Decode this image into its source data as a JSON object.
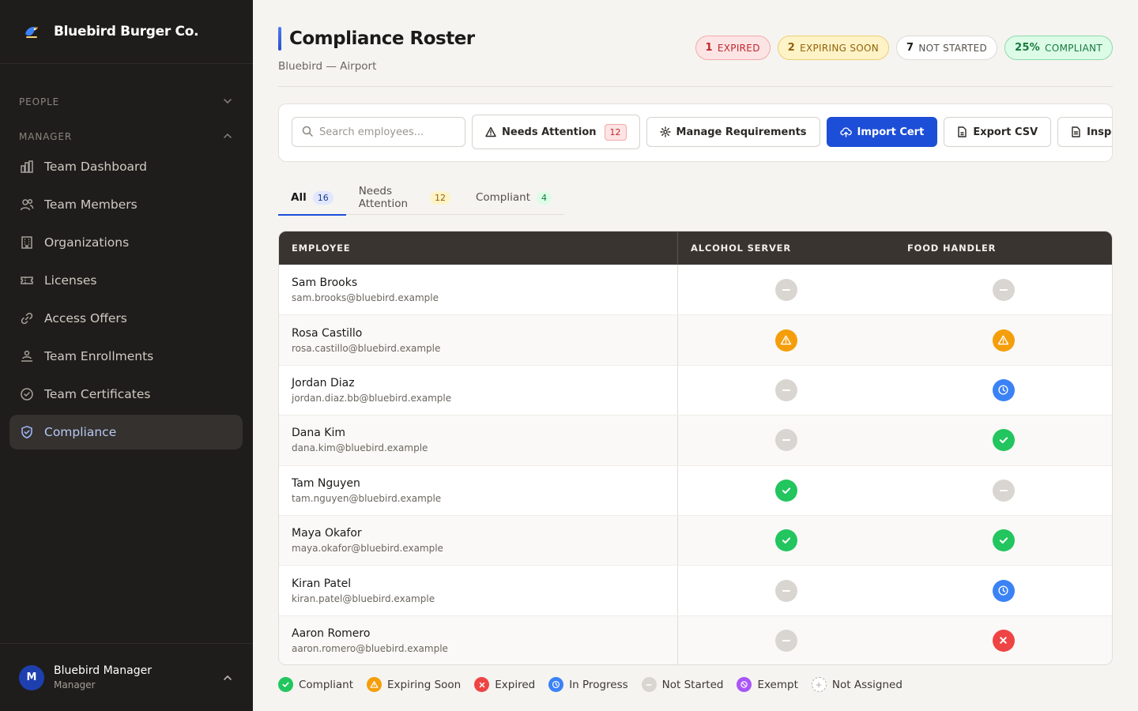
{
  "brand": {
    "name": "Bluebird Burger Co."
  },
  "sidebar": {
    "sections": {
      "people": "PEOPLE",
      "manager": "MANAGER"
    },
    "items": [
      {
        "label": "Team Dashboard",
        "icon": "bar-chart-icon"
      },
      {
        "label": "Team Members",
        "icon": "users-icon"
      },
      {
        "label": "Organizations",
        "icon": "building-icon"
      },
      {
        "label": "Licenses",
        "icon": "ticket-icon"
      },
      {
        "label": "Access Offers",
        "icon": "link-icon"
      },
      {
        "label": "Team Enrollments",
        "icon": "enrollment-icon"
      },
      {
        "label": "Team Certificates",
        "icon": "check-circle-icon"
      },
      {
        "label": "Compliance",
        "icon": "shield-check-icon",
        "active": true
      }
    ],
    "user": {
      "initial": "M",
      "name": "Bluebird Manager",
      "role": "Manager"
    }
  },
  "header": {
    "title": "Compliance Roster",
    "subtitle": "Bluebird — Airport",
    "badges": {
      "expired": {
        "count": "1",
        "label": "EXPIRED"
      },
      "expiring": {
        "count": "2",
        "label": "EXPIRING SOON"
      },
      "not_started": {
        "count": "7",
        "label": "NOT STARTED"
      },
      "compliant": {
        "count": "25%",
        "label": "COMPLIANT"
      }
    }
  },
  "toolbar": {
    "search_placeholder": "Search employees...",
    "needs_attention_label": "Needs Attention",
    "needs_attention_count": "12",
    "manage_label": "Manage Requirements",
    "import_label": "Import Cert",
    "export_label": "Export CSV",
    "inspection_label": "Inspection Packet"
  },
  "tabs": [
    {
      "label": "All",
      "count": "16"
    },
    {
      "label": "Needs Attention",
      "count": "12"
    },
    {
      "label": "Compliant",
      "count": "4"
    }
  ],
  "table": {
    "columns": [
      "EMPLOYEE",
      "ALCOHOL SERVER",
      "FOOD HANDLER"
    ],
    "rows": [
      {
        "name": "Sam Brooks",
        "email": "sam.brooks@bluebird.example",
        "alcohol": "not-started",
        "food": "not-started"
      },
      {
        "name": "Rosa Castillo",
        "email": "rosa.castillo@bluebird.example",
        "alcohol": "expiring",
        "food": "expiring"
      },
      {
        "name": "Jordan Diaz",
        "email": "jordan.diaz.bb@bluebird.example",
        "alcohol": "not-started",
        "food": "in-progress"
      },
      {
        "name": "Dana Kim",
        "email": "dana.kim@bluebird.example",
        "alcohol": "not-started",
        "food": "compliant"
      },
      {
        "name": "Tam Nguyen",
        "email": "tam.nguyen@bluebird.example",
        "alcohol": "compliant",
        "food": "not-started"
      },
      {
        "name": "Maya Okafor",
        "email": "maya.okafor@bluebird.example",
        "alcohol": "compliant",
        "food": "compliant"
      },
      {
        "name": "Kiran Patel",
        "email": "kiran.patel@bluebird.example",
        "alcohol": "not-started",
        "food": "in-progress"
      },
      {
        "name": "Aaron Romero",
        "email": "aaron.romero@bluebird.example",
        "alcohol": "not-started",
        "food": "expired"
      }
    ]
  },
  "legend": {
    "compliant": "Compliant",
    "expiring": "Expiring Soon",
    "expired": "Expired",
    "in_progress": "In Progress",
    "not_started": "Not Started",
    "exempt": "Exempt",
    "not_assigned": "Not Assigned"
  },
  "colors": {
    "accent": "#1d4ed8",
    "compliant": "#22c55e",
    "expiring": "#f59e0b",
    "expired": "#ef4444",
    "in_progress": "#3b82f6",
    "not_started": "#d9d6d1",
    "exempt": "#a855f7"
  }
}
